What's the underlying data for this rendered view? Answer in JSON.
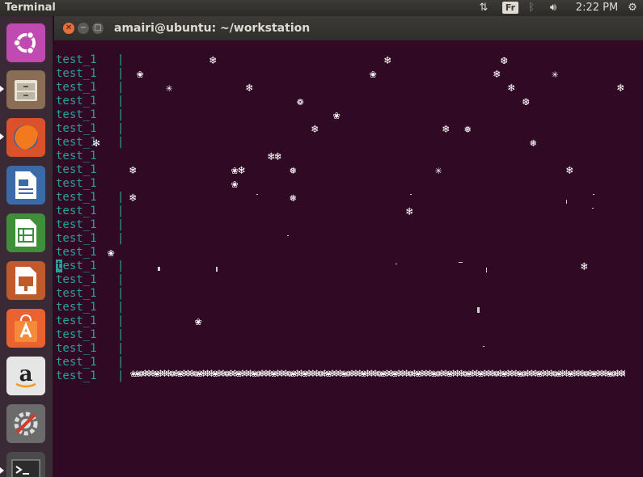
{
  "panel": {
    "app_title": "Terminal",
    "keyboard_layout": "Fr",
    "clock": "2:22 PM"
  },
  "window": {
    "title": "amairi@ubuntu: ~/workstation"
  },
  "launcher": {
    "items": [
      "ubuntu-dash",
      "files",
      "firefox",
      "libreoffice-writer",
      "libreoffice-calc",
      "libreoffice-impress",
      "ubuntu-software",
      "amazon",
      "system-settings",
      "terminal"
    ]
  },
  "terminal": {
    "row_label": "test_1",
    "row_count": 24,
    "separator": "|",
    "snowflake_glyphs": [
      "❄",
      "❀",
      "✻",
      "❆",
      "❅",
      "❁"
    ]
  }
}
